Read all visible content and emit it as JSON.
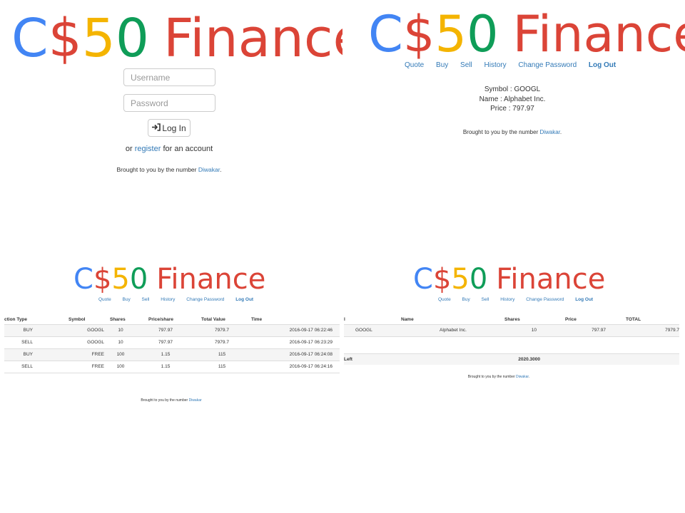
{
  "brand": {
    "c": "C",
    "dollar": "$",
    "five": "5",
    "zero": "0",
    "finance": "Finance"
  },
  "nav": [
    "Quote",
    "Buy",
    "Sell",
    "History",
    "Change Password",
    "Log Out"
  ],
  "footer": {
    "text": "Brought to you by the number",
    "link": "Diwakar",
    "period": "."
  },
  "login": {
    "username_placeholder": "Username",
    "password_placeholder": "Password",
    "button_label": "Log In",
    "register_prefix": "or",
    "register_link": "register",
    "register_suffix": "for an account"
  },
  "quote": {
    "symbol": "Symbol : GOOGL",
    "name": "Name : Alphabet Inc.",
    "price": "Price : 797.97"
  },
  "history": {
    "columns": [
      "ction Type",
      "Symbol",
      "Shares",
      "Price/share",
      "Total Value",
      "Time"
    ],
    "rows": [
      [
        "BUY",
        "GOOGL",
        "10",
        "797.97",
        "7979.7",
        "2016-09-17 06:22:46"
      ],
      [
        "SELL",
        "GOOGL",
        "10",
        "797.97",
        "7979.7",
        "2016-09-17 06:23:29"
      ],
      [
        "BUY",
        "FREE",
        "100",
        "1.15",
        "115",
        "2016-09-17 06:24:08"
      ],
      [
        "SELL",
        "FREE",
        "100",
        "1.15",
        "115",
        "2016-09-17 06:24:16"
      ]
    ]
  },
  "portfolio": {
    "columns": [
      "l",
      "Name",
      "Shares",
      "Price",
      "TOTAL"
    ],
    "rows": [
      [
        "GOOGL",
        "Alphabet Inc.",
        "10",
        "797.97",
        "7979.7"
      ]
    ],
    "cash_label": "Left",
    "cash_value": "2020.3000"
  }
}
